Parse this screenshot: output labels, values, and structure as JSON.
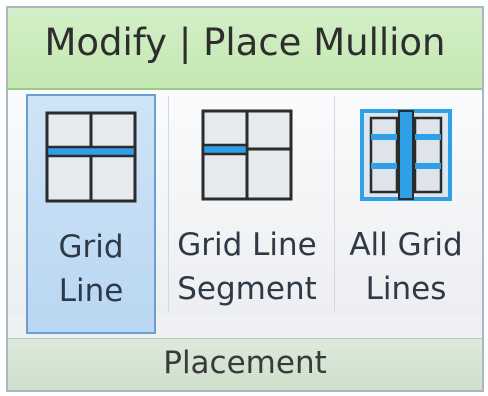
{
  "ribbon": {
    "tab_title": "Modify | Place Mullion",
    "panel_label": "Placement",
    "tools": [
      {
        "line1": "Grid",
        "line2": "Line",
        "icon": "grid-line-icon",
        "selected": true
      },
      {
        "line1": "Grid Line",
        "line2": "Segment",
        "icon": "grid-line-segment-icon",
        "selected": false
      },
      {
        "line1": "All Grid",
        "line2": "Lines",
        "icon": "all-grid-lines-icon",
        "selected": false
      }
    ]
  },
  "colors": {
    "tab_green": "#c4e8b2",
    "selected_blue": "#b9d6f2",
    "icon_highlight": "#1e9be8"
  }
}
